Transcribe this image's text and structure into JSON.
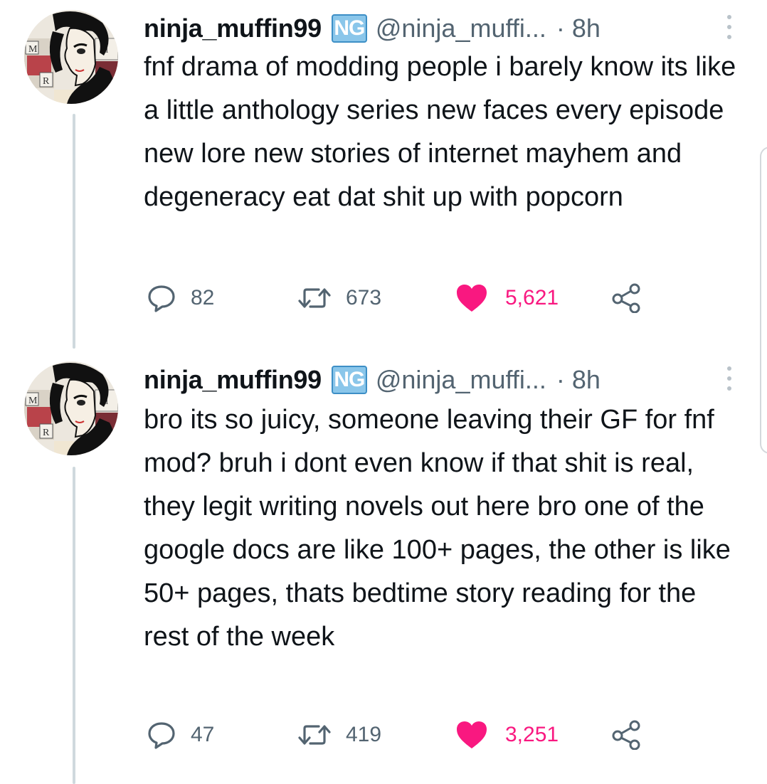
{
  "tweets": [
    {
      "author": {
        "display_name": "ninja_muffin99",
        "badge": "NG",
        "handle": "@ninja_muffi...",
        "avatar_icon": "manga-portrait-avatar"
      },
      "separator": "·",
      "time": "8h",
      "text": "fnf drama of modding people i barely know its like a little anthology series new faces every episode new lore new stories of internet mayhem and degeneracy eat dat shit up with popcorn",
      "stats": {
        "replies": "82",
        "retweets": "673",
        "likes": "5,621"
      },
      "liked": true
    },
    {
      "author": {
        "display_name": "ninja_muffin99",
        "badge": "NG",
        "handle": "@ninja_muffi...",
        "avatar_icon": "manga-portrait-avatar"
      },
      "separator": "·",
      "time": "8h",
      "text": "bro its so juicy, someone leaving their GF for fnf mod? bruh i dont even know if that shit is real, they legit writing novels out here bro one of the google docs are like 100+ pages, the other is like 50+ pages, thats bedtime story reading for the rest of the week",
      "stats": {
        "replies": "47",
        "retweets": "419",
        "likes": "3,251"
      },
      "liked": true
    }
  ],
  "colors": {
    "text": "#0f1419",
    "secondary": "#536471",
    "like": "#f91880",
    "thread_line": "#cfd9de",
    "badge_bg": "#8ac6ea"
  }
}
